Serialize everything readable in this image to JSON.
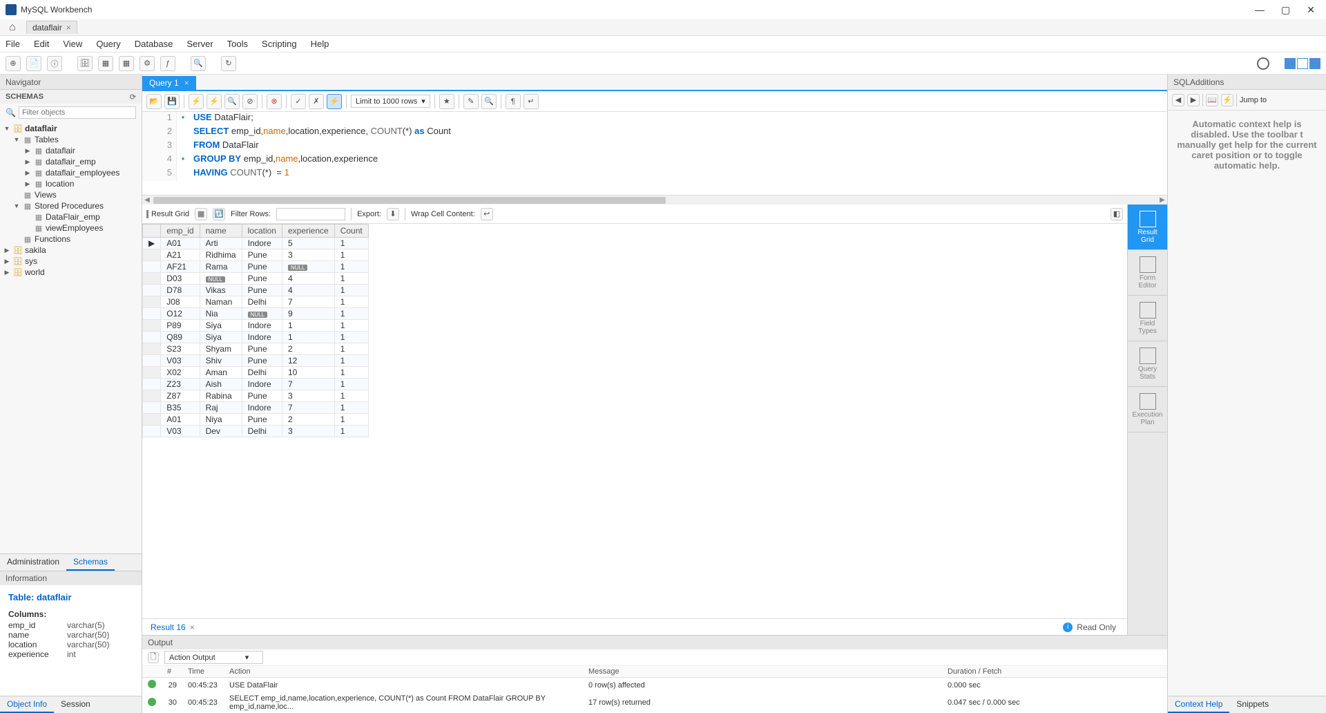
{
  "app": {
    "title": "MySQL Workbench",
    "conn_tab": "dataflair"
  },
  "menu": [
    "File",
    "Edit",
    "View",
    "Query",
    "Database",
    "Server",
    "Tools",
    "Scripting",
    "Help"
  ],
  "navigator": {
    "title": "Navigator",
    "schemas_label": "SCHEMAS",
    "filter_placeholder": "Filter objects",
    "tree": {
      "db": "dataflair",
      "tables_label": "Tables",
      "tables": [
        "dataflair",
        "dataflair_emp",
        "dataflair_employees",
        "location"
      ],
      "views_label": "Views",
      "sp_label": "Stored Procedures",
      "sps": [
        "DataFlair_emp",
        "viewEmployees"
      ],
      "functions_label": "Functions",
      "other_dbs": [
        "sakila",
        "sys",
        "world"
      ]
    },
    "tabs": {
      "admin": "Administration",
      "schemas": "Schemas"
    }
  },
  "info": {
    "header": "Information",
    "title_prefix": "Table: ",
    "title_value": "dataflair",
    "cols_label": "Columns:",
    "cols": [
      {
        "n": "emp_id",
        "t": "varchar(5)"
      },
      {
        "n": "name",
        "t": "varchar(50)"
      },
      {
        "n": "location",
        "t": "varchar(50)"
      },
      {
        "n": "experience",
        "t": "int"
      }
    ],
    "bottom_tabs": {
      "objinfo": "Object Info",
      "session": "Session"
    }
  },
  "query": {
    "tab": "Query 1",
    "limit_label": "Limit to 1000 rows",
    "lines": [
      {
        "n": "1",
        "marker": "•",
        "html": "<span class='kw'>USE</span> DataFlair;"
      },
      {
        "n": "2",
        "marker": "",
        "html": "<span class='kw'>SELECT</span> emp_id,<span class='id'>name</span>,location,experience, <span class='fn'>COUNT</span>(*) <span class='kw'>as</span> Count"
      },
      {
        "n": "3",
        "marker": "",
        "html": "<span class='kw'>FROM</span> DataFlair"
      },
      {
        "n": "4",
        "marker": "•",
        "html": "<span class='kw'>GROUP BY</span> emp_id,<span class='id'>name</span>,location,experience"
      },
      {
        "n": "5",
        "marker": "",
        "html": "<span class='kw'>HAVING</span> <span class='fn'>COUNT</span>(*)  = <span class='num'>1</span>"
      }
    ]
  },
  "results": {
    "toolbar": {
      "grid_label": "Result Grid",
      "filter_label": "Filter Rows:",
      "export_label": "Export:",
      "wrap_label": "Wrap Cell Content:"
    },
    "columns": [
      "emp_id",
      "name",
      "location",
      "experience",
      "Count"
    ],
    "rows": [
      [
        "A01",
        "Arti",
        "Indore",
        "5",
        "1"
      ],
      [
        "A21",
        "Ridhima",
        "Pune",
        "3",
        "1"
      ],
      [
        "AF21",
        "Rama",
        "Pune",
        "NULL",
        "1"
      ],
      [
        "D03",
        "NULL",
        "Pune",
        "4",
        "1"
      ],
      [
        "D78",
        "Vikas",
        "Pune",
        "4",
        "1"
      ],
      [
        "J08",
        "Naman",
        "Delhi",
        "7",
        "1"
      ],
      [
        "O12",
        "Nia",
        "NULL",
        "9",
        "1"
      ],
      [
        "P89",
        "Siya",
        "Indore",
        "1",
        "1"
      ],
      [
        "Q89",
        "Siya",
        "Indore",
        "1",
        "1"
      ],
      [
        "S23",
        "Shyam",
        "Pune",
        "2",
        "1"
      ],
      [
        "V03",
        "Shiv",
        "Pune",
        "12",
        "1"
      ],
      [
        "X02",
        "Aman",
        "Delhi",
        "10",
        "1"
      ],
      [
        "Z23",
        "Aish",
        "Indore",
        "7",
        "1"
      ],
      [
        "Z87",
        "Rabina",
        "Pune",
        "3",
        "1"
      ],
      [
        "B35",
        "Raj",
        "Indore",
        "7",
        "1"
      ],
      [
        "A01",
        "Niya",
        "Pune",
        "2",
        "1"
      ],
      [
        "V03",
        "Dev",
        "Delhi",
        "3",
        "1"
      ]
    ],
    "result_tab": "Result 16",
    "readonly": "Read Only",
    "sidebtns": [
      "Result Grid",
      "Form Editor",
      "Field Types",
      "Query Stats",
      "Execution Plan"
    ]
  },
  "output": {
    "header": "Output",
    "dropdown": "Action Output",
    "cols": [
      "#",
      "Time",
      "Action",
      "Message",
      "Duration / Fetch"
    ],
    "rows": [
      {
        "n": "29",
        "t": "00:45:23",
        "a": "USE DataFlair",
        "m": "0 row(s) affected",
        "d": "0.000 sec"
      },
      {
        "n": "30",
        "t": "00:45:23",
        "a": "SELECT emp_id,name,location,experience, COUNT(*) as Count FROM DataFlair GROUP BY emp_id,name,loc...",
        "m": "17 row(s) returned",
        "d": "0.047 sec / 0.000 sec"
      }
    ]
  },
  "sqladd": {
    "header": "SQLAdditions",
    "jump_label": "Jump to",
    "body": "Automatic context help is disabled. Use the toolbar t manually get help for the current caret position or to toggle automatic help.",
    "tabs": {
      "context": "Context Help",
      "snippets": "Snippets"
    }
  }
}
